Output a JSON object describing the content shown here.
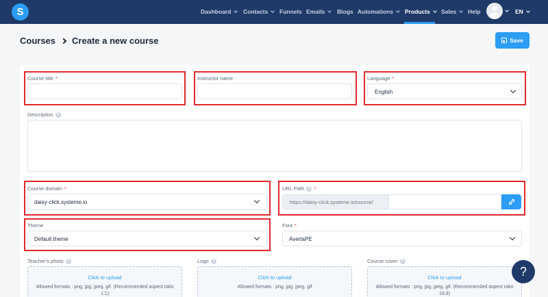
{
  "nav": {
    "logo_letter": "S",
    "items": [
      {
        "label": "Dashboard"
      },
      {
        "label": "Contacts"
      },
      {
        "label": "Funnels"
      },
      {
        "label": "Emails"
      },
      {
        "label": "Blogs"
      },
      {
        "label": "Automations"
      },
      {
        "label": "Products"
      },
      {
        "label": "Sales"
      },
      {
        "label": "Help"
      }
    ],
    "active_item": "Products",
    "lang": "EN"
  },
  "header": {
    "breadcrumb_root": "Courses",
    "breadcrumb_current": "Create a new course",
    "save_label": "Save"
  },
  "form": {
    "course_title_label": "Course title",
    "course_title_value": "",
    "instructor_label": "Instructor name",
    "instructor_value": "",
    "language_label": "Language",
    "language_value": "English",
    "description_label": "Description",
    "description_value": "",
    "domain_label": "Course domain",
    "domain_value": "daisy-click.systeme.io",
    "url_path_label": "URL Path",
    "url_prefix": "https://daisy-click.systeme.io/course/",
    "url_path_value": "",
    "theme_label": "Theme",
    "theme_value": "Default theme",
    "font_label": "Font",
    "font_value": "AvertaPE",
    "required_mark": "*",
    "info_glyph": "?"
  },
  "uploads": {
    "teacher_label": "Teacher's photo",
    "teacher_link": "Click to upload",
    "teacher_hint": "Allowed formats : png, jpg, jpeg, gif. (Recommended aspect ratio 1:1)",
    "logo_label": "Logo",
    "logo_link": "Click to upload",
    "logo_hint": "Allowed formats : png, jpg, jpeg, gif",
    "cover_label": "Course cover",
    "cover_link": "Click to upload",
    "cover_hint": "Allowed formats : png, jpg, jpeg, gif. (Recommended aspect ratio 16:9)"
  },
  "help_glyph": "?",
  "colors": {
    "nav_bg": "#1f3a68",
    "accent": "#2b9df4",
    "highlight": "#e0262b",
    "required": "#e53935"
  }
}
